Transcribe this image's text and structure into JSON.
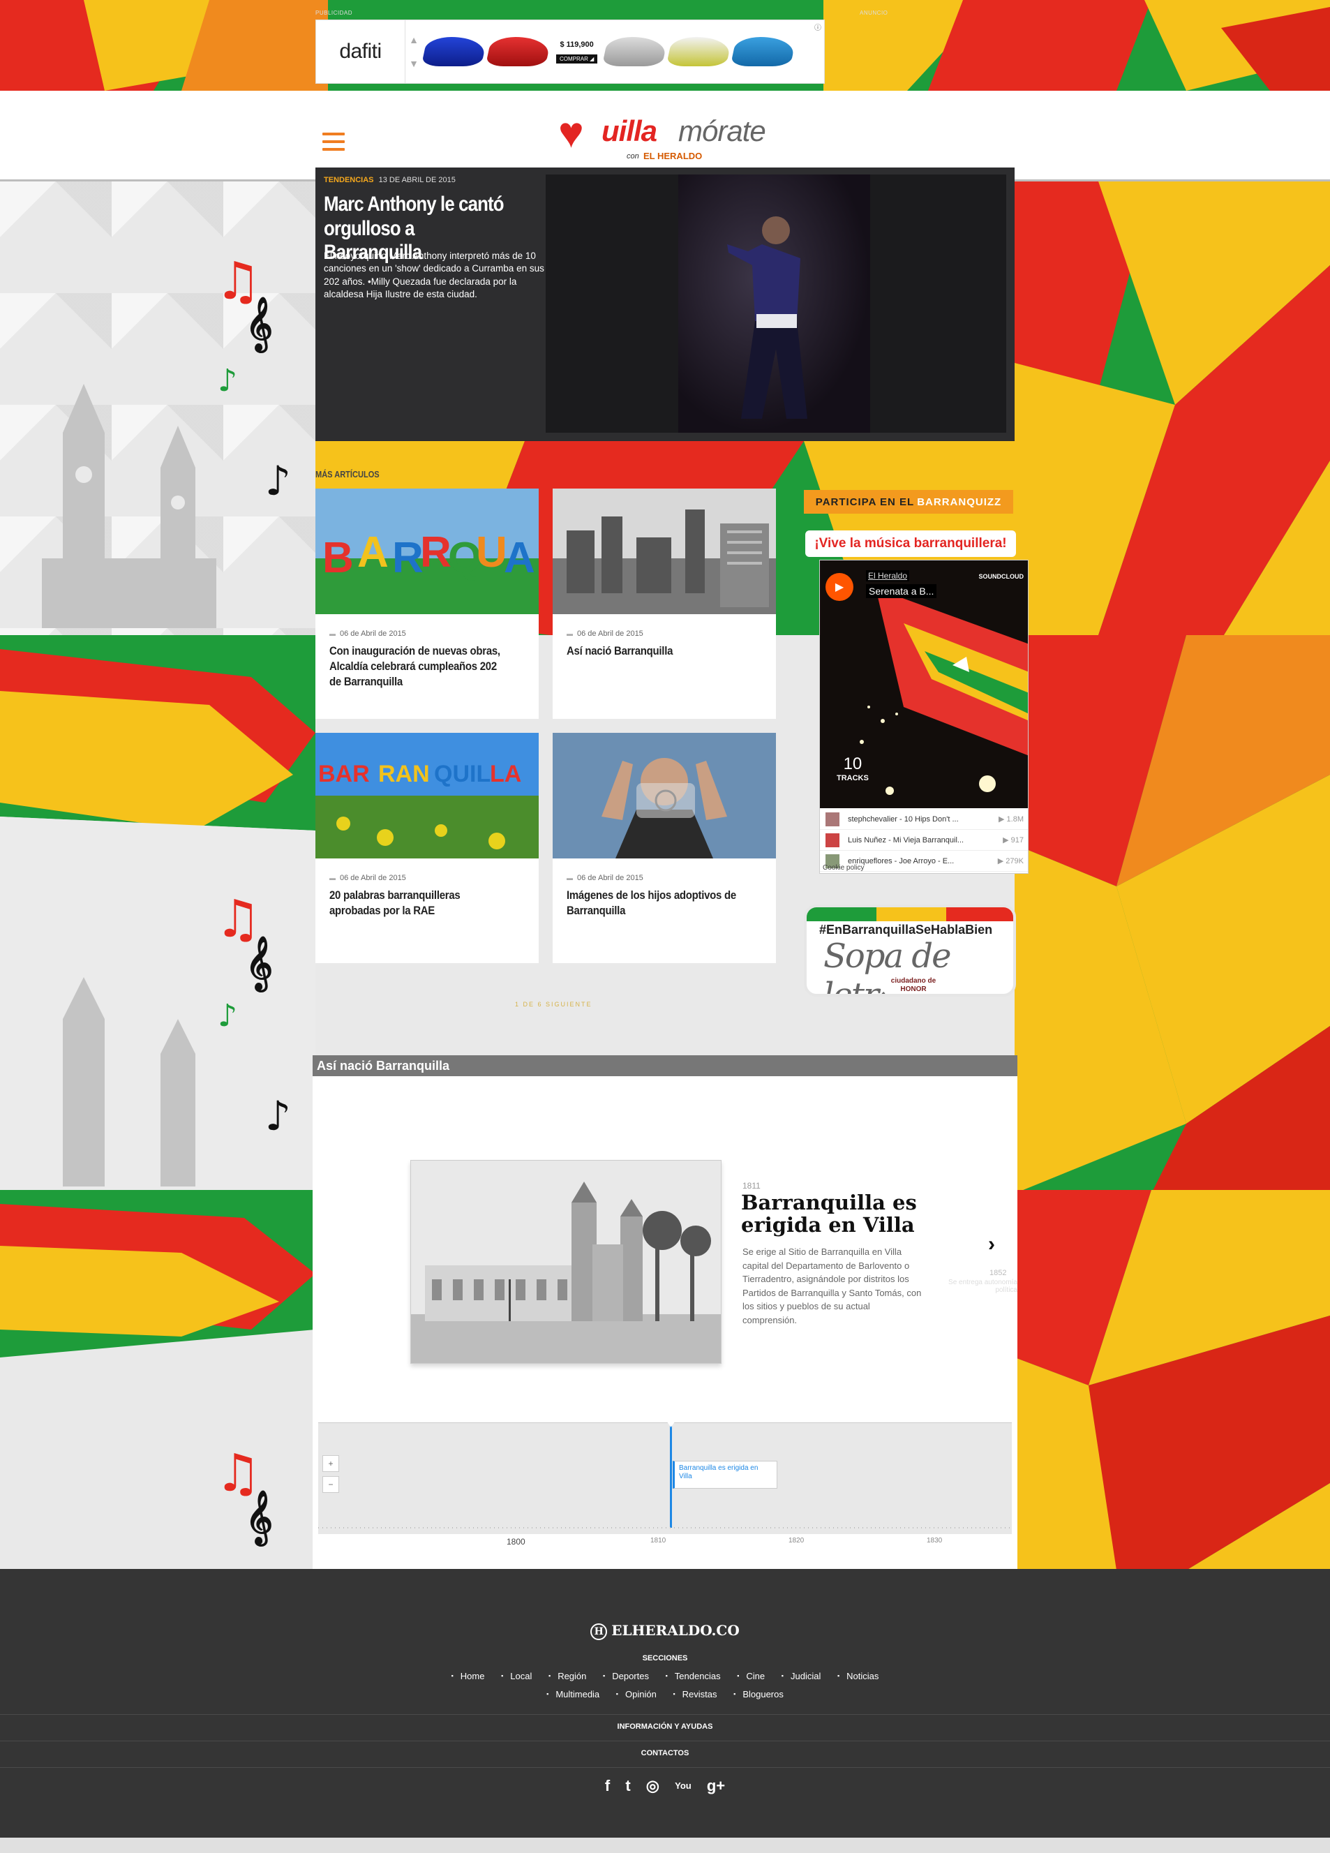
{
  "ad": {
    "left_label": "PUBLICIDAD",
    "right_label": "ANUNCIO",
    "brand": "dafiti",
    "price": "$ 119,900",
    "buy": "COMPRAR ◢",
    "info_icon": "info-icon"
  },
  "header": {
    "logo_main": "uilla",
    "logo_second": "mórate",
    "logo_con": "con",
    "logo_heraldo": "EL HERALDO",
    "menu_icon": "hamburger-icon"
  },
  "hero": {
    "tag": "TENDENCIAS",
    "date": "13 DE ABRIL DE 2015",
    "title": "Marc Anthony le cantó orgulloso a Barranquilla",
    "description": "El neoyorquino Marc Anthony interpretó más de 10 canciones en un 'show' dedicado a Curramba en sus 202 años. •Milly Quezada fue declarada por la alcaldesa Hija Ilustre de esta ciudad."
  },
  "more": {
    "label": "MÁS ARTÍCULOS",
    "cards": [
      {
        "date": "06 de Abril de 2015",
        "title": "Con inauguración de nuevas obras, Alcaldía celebrará cumpleaños 202 de Barranquilla"
      },
      {
        "date": "06 de Abril de 2015",
        "title": "Así nació Barranquilla"
      },
      {
        "date": "06 de Abril de 2015",
        "title": "20 palabras barranquilleras aprobadas por la RAE"
      },
      {
        "date": "06 de Abril de 2015",
        "title": "Imágenes de los hijos adoptivos de Barranquilla"
      }
    ],
    "pager": "1 DE 6    SIGUIENTE"
  },
  "sidebar": {
    "quizz_prefix": "PARTICIPA EN EL",
    "quizz_name": "BARRANQUIZZ",
    "vive": "¡Vive la música barranquillera!",
    "soundcloud": {
      "user": "El Heraldo",
      "track": "Serenata a B...",
      "brand": "SOUNDCLOUD",
      "count": "10",
      "count_label": "TRACKS",
      "tracks": [
        {
          "title": "stephchevalier - 10 Hips Don't ...",
          "plays": "▶ 1.8M"
        },
        {
          "title": "Luis Nuñez - Mi Vieja Barranquil...",
          "plays": "▶ 917"
        },
        {
          "title": "enriqueflores - Joe Arroyo - E...",
          "plays": "▶ 279K"
        }
      ],
      "cookie": "Cookie policy"
    },
    "sopa_hashtag": "#EnBarranquillaSeHablaBien",
    "sopa_title": "Sopa de letras",
    "sopa_badge": "ciudadano de HONOR"
  },
  "timeline": {
    "header": "Así nació Barranquilla",
    "year": "1811",
    "title": "Barranquilla es erigida en Villa",
    "description": "Se erige al Sitio de Barranquilla en Villa capital del Departamento de Barlovento o Tierradentro, asignándole por distritos los Partidos de Barranquilla y Santo Tomás, con los sitios y pueblos de su actual comprensión.",
    "next_year": "1852",
    "next_label": "Se entrega autonomía política",
    "marker": "Barranquilla es erigida en Villa",
    "ticks": [
      "1800",
      "1810",
      "1820",
      "1830"
    ],
    "zoom_in": "+",
    "zoom_out": "−"
  },
  "footer": {
    "logo": "ELHERALDO.CO",
    "sections_label": "SECCIONES",
    "links_row1": [
      "Home",
      "Local",
      "Región",
      "Deportes",
      "Tendencias",
      "Cine",
      "Judicial",
      "Noticias"
    ],
    "links_row2": [
      "Multimedia",
      "Opinión",
      "Revistas",
      "Blogueros"
    ],
    "info": "INFORMACIÓN Y AYUDAS",
    "contacts": "CONTACTOS",
    "social": [
      "f",
      "t",
      "◎",
      "You",
      "g+"
    ]
  }
}
